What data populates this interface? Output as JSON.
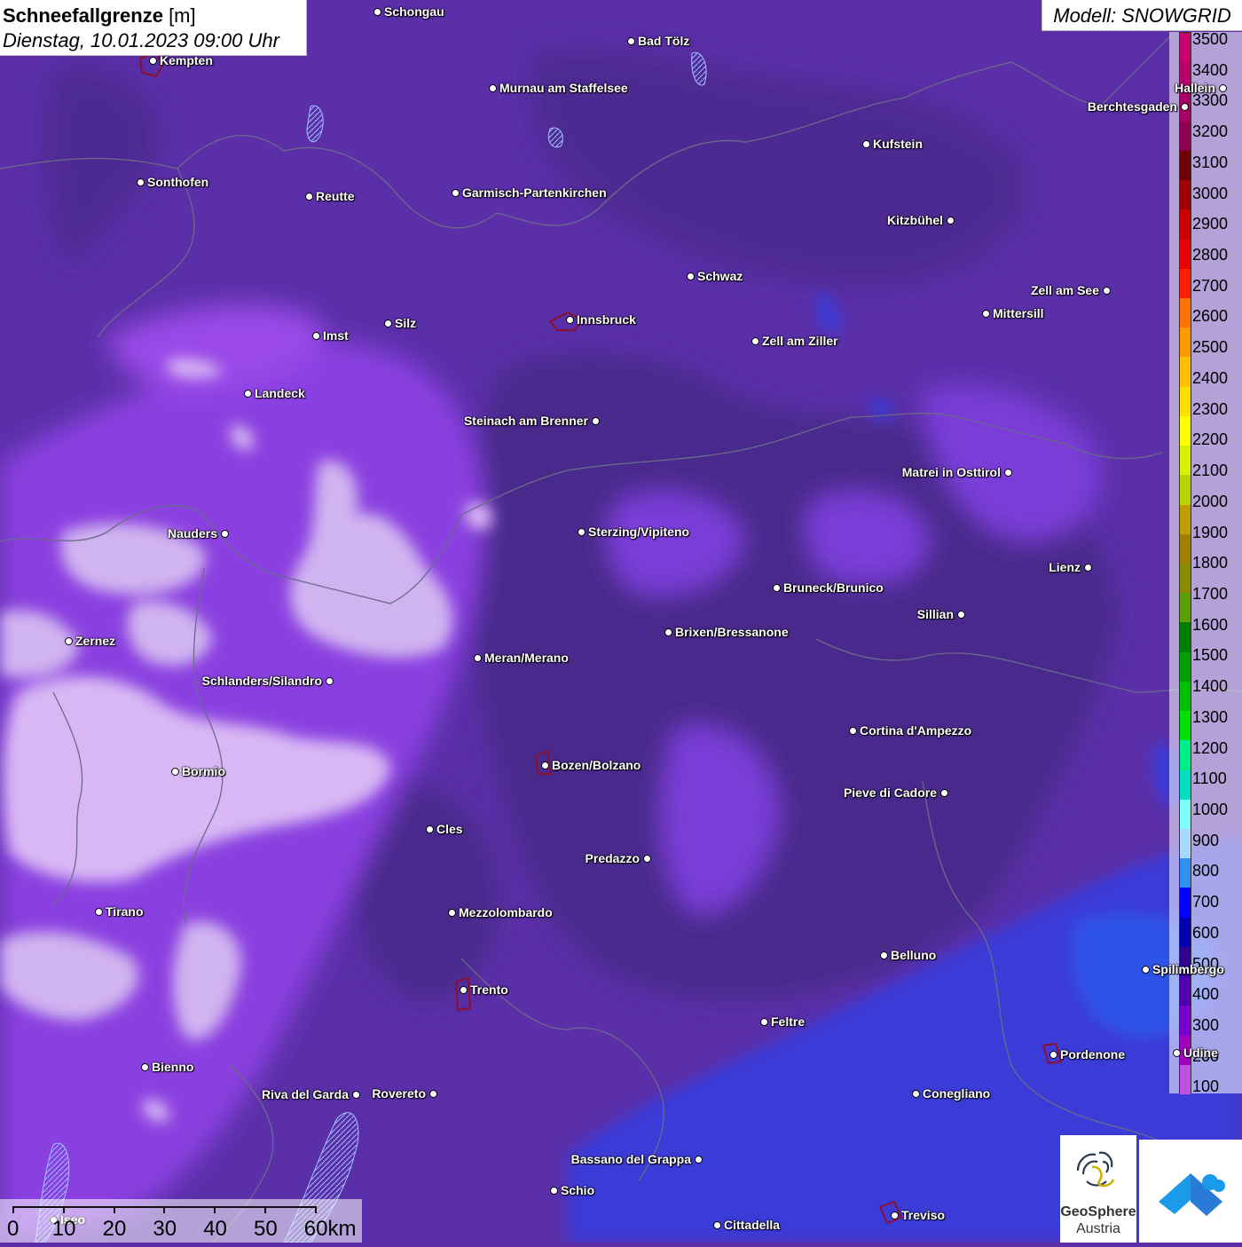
{
  "header": {
    "title_bold": "Schneefallgrenze",
    "title_unit": " [m]",
    "datetime": "Dienstag, 10.01.2023 09:00 Uhr"
  },
  "model_label": "Modell: SNOWGRID",
  "legend": {
    "labels": [
      "3500",
      "3400",
      "3300",
      "3200",
      "3100",
      "3000",
      "2900",
      "2800",
      "2700",
      "2600",
      "2500",
      "2400",
      "2300",
      "2200",
      "2100",
      "2000",
      "1900",
      "1800",
      "1700",
      "1600",
      "1500",
      "1400",
      "1300",
      "1200",
      "1100",
      "1000",
      "900",
      "800",
      "700",
      "600",
      "500",
      "400",
      "300",
      "200",
      "100"
    ],
    "colors": [
      "#c8006e",
      "#b8006a",
      "#a80066",
      "#8e0050",
      "#6e0000",
      "#a00000",
      "#c80000",
      "#e60000",
      "#ff2000",
      "#ff7000",
      "#ff9a00",
      "#ffc000",
      "#ffe000",
      "#ffff00",
      "#d8f000",
      "#b8d400",
      "#c0a000",
      "#a08000",
      "#8a8a00",
      "#5aa000",
      "#008000",
      "#00a000",
      "#00c000",
      "#00e000",
      "#00ee88",
      "#00e0c0",
      "#80ffff",
      "#a8d8ff",
      "#3090f0",
      "#0000ff",
      "#0000b0",
      "#300090",
      "#5000b0",
      "#7a00d0",
      "#a000c0",
      "#c050e0"
    ]
  },
  "map": {
    "colors": {
      "background": "#5a2fa8",
      "dark_area": "#4a2a8c",
      "mid_area": "#7a3cd8",
      "light_area": "#b48cf0",
      "pale_area": "#d8b8f4",
      "blue_area": "#3a3ad8",
      "border": "#6a6a8a"
    },
    "cities": [
      {
        "name": "Schongau"
      },
      {
        "name": "Bad Tölz"
      },
      {
        "name": "Kempten"
      },
      {
        "name": "Murnau am Staffelsee"
      },
      {
        "name": "Hallein"
      },
      {
        "name": "Berchtesgaden"
      },
      {
        "name": "Kufstein"
      },
      {
        "name": "Sonthofen"
      },
      {
        "name": "Reutte"
      },
      {
        "name": "Garmisch-Partenkirchen"
      },
      {
        "name": "Kitzbühel"
      },
      {
        "name": "Schwaz"
      },
      {
        "name": "Zell am See"
      },
      {
        "name": "Mittersill"
      },
      {
        "name": "Innsbruck"
      },
      {
        "name": "Silz"
      },
      {
        "name": "Imst"
      },
      {
        "name": "Zell am Ziller"
      },
      {
        "name": "Landeck"
      },
      {
        "name": "Steinach am Brenner"
      },
      {
        "name": "Matrei in Osttirol"
      },
      {
        "name": "Nauders"
      },
      {
        "name": "Sterzing/Vipiteno"
      },
      {
        "name": "Lienz"
      },
      {
        "name": "Bruneck/Brunico"
      },
      {
        "name": "Sillian"
      },
      {
        "name": "Zernez"
      },
      {
        "name": "Brixen/Bressanone"
      },
      {
        "name": "Meran/Merano"
      },
      {
        "name": "Schlanders/Silandro"
      },
      {
        "name": "Cortina d'Ampezzo"
      },
      {
        "name": "Bozen/Bolzano"
      },
      {
        "name": "Bormio"
      },
      {
        "name": "Pieve di Cadore"
      },
      {
        "name": "Cles"
      },
      {
        "name": "Predazzo"
      },
      {
        "name": "Tirano"
      },
      {
        "name": "Mezzolombardo"
      },
      {
        "name": "Belluno"
      },
      {
        "name": "Spilimbergo"
      },
      {
        "name": "Trento"
      },
      {
        "name": "Feltre"
      },
      {
        "name": "Pordenone"
      },
      {
        "name": "Udine"
      },
      {
        "name": "Bienno"
      },
      {
        "name": "Riva del Garda"
      },
      {
        "name": "Rovereto"
      },
      {
        "name": "Conegliano"
      },
      {
        "name": "Bassano del Grappa"
      },
      {
        "name": "Schio"
      },
      {
        "name": "Treviso"
      },
      {
        "name": "Iseo"
      },
      {
        "name": "Cittadella"
      }
    ]
  },
  "scalebar": {
    "labels": [
      "0",
      "10",
      "20",
      "30",
      "40",
      "50",
      "60km"
    ]
  },
  "logo": {
    "name": "GeoSphere",
    "sub": "Austria"
  }
}
